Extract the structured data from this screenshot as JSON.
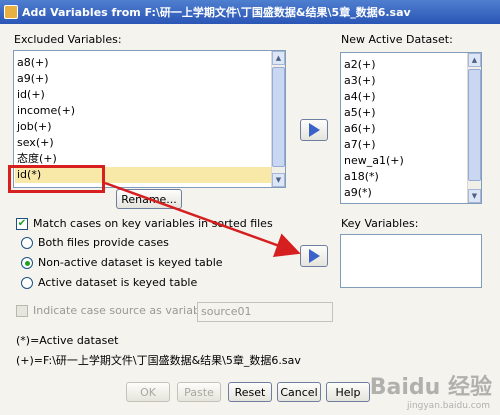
{
  "window": {
    "title": "Add Variables from F:\\研一上学期文件\\丁国盛数据&结果\\5章_数据6.sav"
  },
  "excluded": {
    "label": "Excluded Variables:",
    "items": [
      {
        "label": "a8(+)"
      },
      {
        "label": "a9(+)"
      },
      {
        "label": "id(+)"
      },
      {
        "label": "income(+)"
      },
      {
        "label": "job(+)"
      },
      {
        "label": "sex(+)"
      },
      {
        "label": "态度(+)"
      },
      {
        "label": "id(*)",
        "selected": true
      }
    ]
  },
  "active": {
    "label": "New Active Dataset:",
    "items": [
      {
        "label": "a2(+)"
      },
      {
        "label": "a3(+)"
      },
      {
        "label": "a4(+)"
      },
      {
        "label": "a5(+)"
      },
      {
        "label": "a6(+)"
      },
      {
        "label": "a7(+)"
      },
      {
        "label": "new_a1(+)"
      },
      {
        "label": "a18(*)"
      },
      {
        "label": "a9(*)"
      }
    ]
  },
  "key_variables": {
    "label": "Key Variables:"
  },
  "buttons": {
    "rename": "Rename...",
    "ok": "OK",
    "paste": "Paste",
    "reset": "Reset",
    "cancel": "Cancel",
    "help": "Help"
  },
  "options": {
    "match_cases": {
      "label": "Match cases on key variables in sorted files",
      "checked": true
    },
    "both_files": {
      "label": "Both files provide cases",
      "selected": false
    },
    "non_active_keyed": {
      "label": "Non-active dataset is keyed table",
      "selected": true
    },
    "active_keyed": {
      "label": "Active dataset is keyed table",
      "selected": false
    },
    "indicate_source": {
      "label": "Indicate case source as variable:",
      "checked": false,
      "value": "source01"
    }
  },
  "legend": {
    "active_note": "(*)=Active dataset",
    "file_note": "(+)=F:\\研一上学期文件\\丁国盛数据&结果\\5章_数据6.sav"
  },
  "watermark": {
    "text": "Baidu 经验",
    "sub": "jingyan.baidu.com"
  },
  "colors": {
    "accent": "#3a62c9",
    "annotation": "#d61f1f",
    "selection": "#f9e9a8"
  }
}
